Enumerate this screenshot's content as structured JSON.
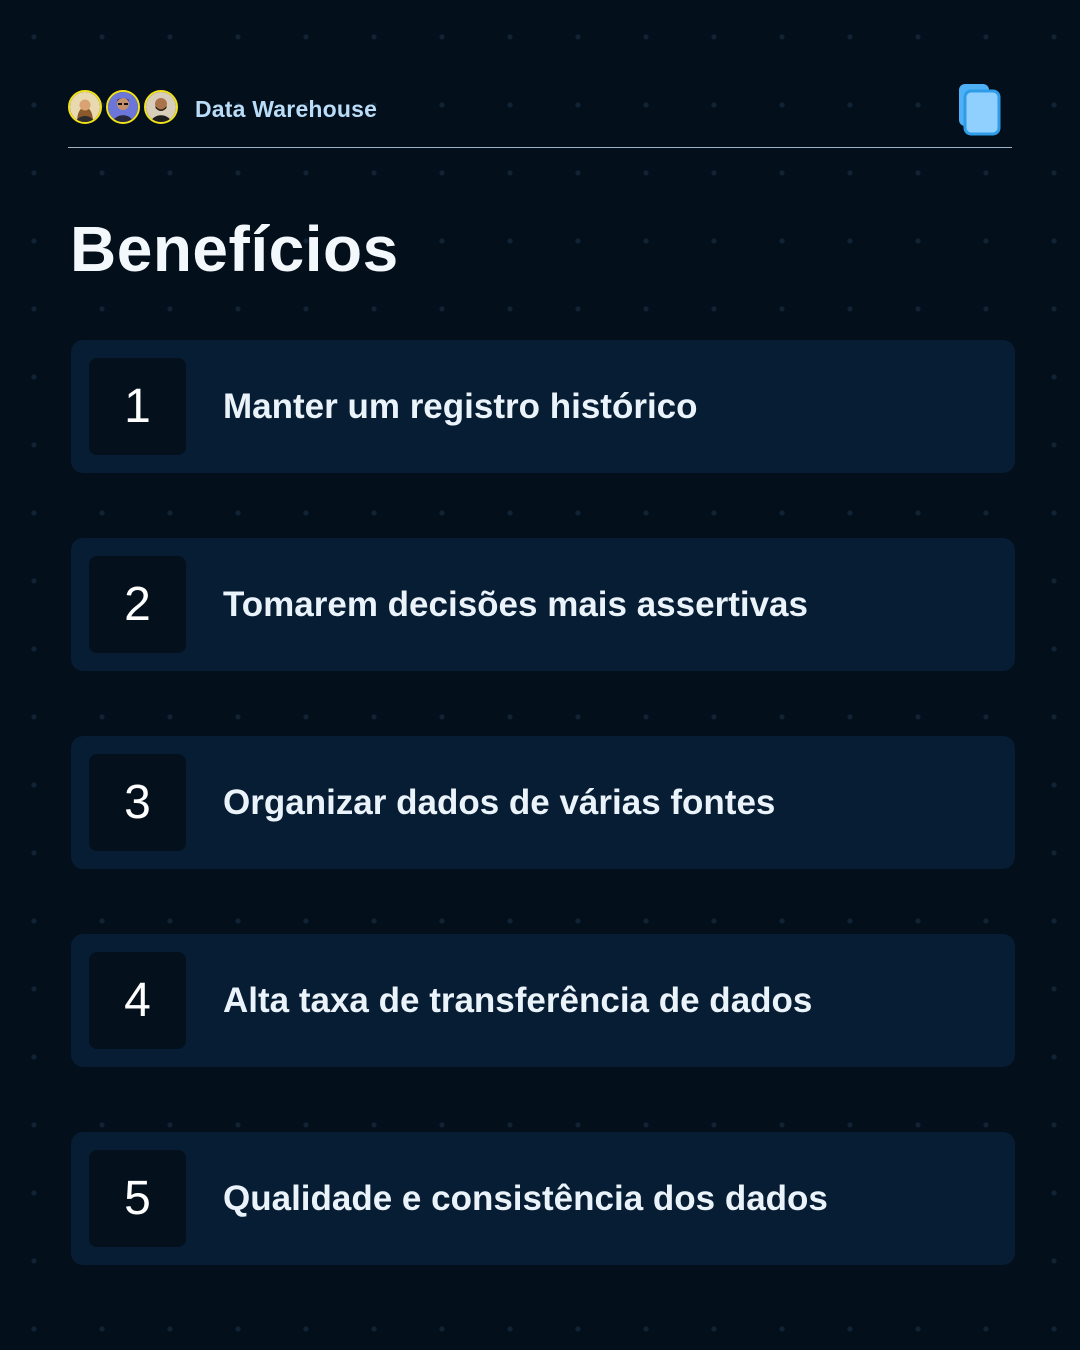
{
  "header": {
    "title": "Data Warehouse",
    "avatars": [
      "avatar-woman",
      "avatar-man-glasses",
      "avatar-man-beard"
    ],
    "icon": "copy-pages-icon",
    "accent_color": "#f2e21b"
  },
  "page_title": "Benefícios",
  "items": [
    {
      "number": "1",
      "text": "Manter um registro histórico"
    },
    {
      "number": "2",
      "text": "Tomarem decisões mais assertivas"
    },
    {
      "number": "3",
      "text": "Organizar dados de várias fontes"
    },
    {
      "number": "4",
      "text": "Alta taxa de transferência de dados"
    },
    {
      "number": "5",
      "text": "Qualidade e consistência dos dados"
    }
  ],
  "colors": {
    "background": "#030f1a",
    "card": "#071d33",
    "number_box": "#04111d",
    "brand_text": "#b9dcf8",
    "icon_blue": "#8fd0ff"
  }
}
